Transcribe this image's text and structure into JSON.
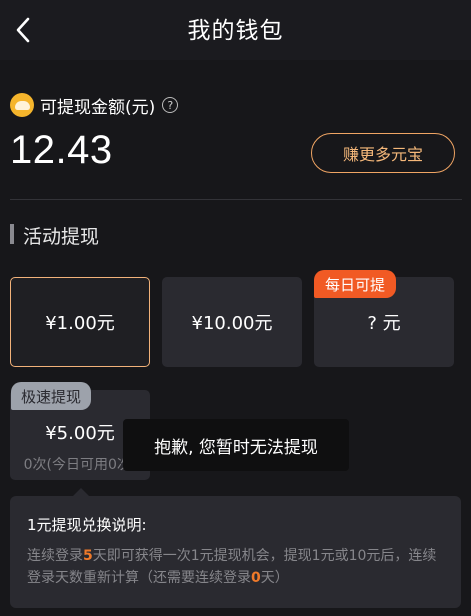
{
  "header": {
    "title": "我的钱包",
    "back_icon": "chevron-left-icon"
  },
  "balance": {
    "icon": "coin-icon",
    "label": "可提现金额(元)",
    "help_icon": "question-circle-icon",
    "amount": "12.43",
    "earn_button": "赚更多元宝"
  },
  "section": {
    "title": "活动提现"
  },
  "options": [
    {
      "label": "¥1.00元",
      "selected": true
    },
    {
      "label": "¥10.00元",
      "selected": false
    },
    {
      "label": "? 元",
      "badge": "每日可提",
      "selected": false
    },
    {
      "label": "¥5.00元",
      "badge": "极速提现",
      "sub": "0次(今日可用0次)",
      "selected": false
    }
  ],
  "toast": "抱歉, 您暂时无法提现",
  "info": {
    "title": "1元提现兑换说明:",
    "text_parts": [
      "连续登录",
      "5",
      "天即可获得一次1元提现机会，提现1元或10元后，连续登录天数重新计算（还需要连续登录",
      "0",
      "天）"
    ]
  },
  "colors": {
    "accent": "#f15a24",
    "gold": "#f5b52c",
    "outline": "#f0a564"
  }
}
